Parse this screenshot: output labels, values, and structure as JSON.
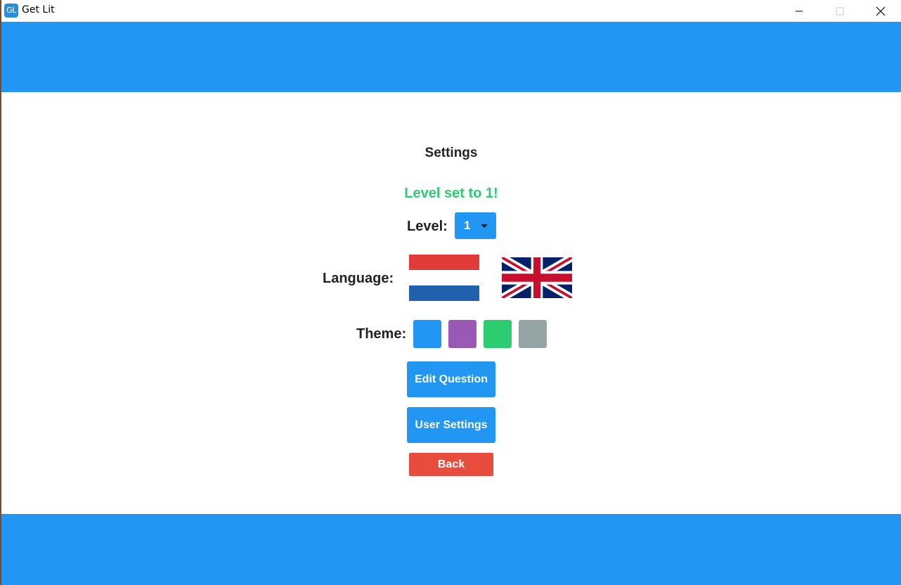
{
  "window": {
    "icon_text": "GL",
    "title": "Get Lit"
  },
  "settings": {
    "title": "Settings",
    "status_message": "Level set to 1!",
    "level_label": "Level:",
    "level_value": "1",
    "language_label": "Language:",
    "languages": [
      "dutch-flag",
      "uk-flag"
    ],
    "theme_label": "Theme:",
    "theme_colors": [
      "#2196f3",
      "#9b59b6",
      "#2ecc71",
      "#95a5a6"
    ],
    "edit_question_label": "Edit Question",
    "user_settings_label": "User Settings",
    "back_label": "Back"
  },
  "colors": {
    "primary": "#2196f3",
    "success": "#2ecc71",
    "danger": "#e74c3c"
  }
}
